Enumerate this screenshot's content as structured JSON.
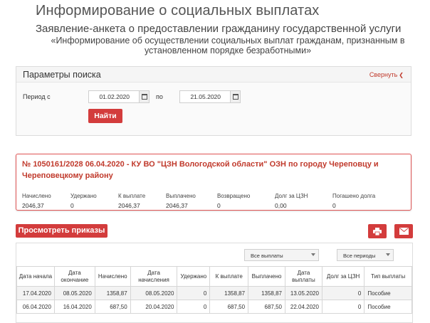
{
  "header": {
    "title": "Информирование о социальных выплатах",
    "subtitle": "Заявление-анкета о предоставлении гражданину государственной услуги",
    "service_line1": "«Информирование об осуществлении социальных выплат гражданам, признанным в",
    "service_line2": "установленном порядке безработными»"
  },
  "search": {
    "title": "Параметры поиска",
    "collapse_label": "Свернуть",
    "period_label": "Период с",
    "to_label": "по",
    "date_from": "01.02.2020",
    "date_to": "21.05.2020",
    "find_label": "Найти"
  },
  "record": {
    "title": "№ 1050161/2028 06.04.2020 - КУ ВО \"ЦЗН Вологодской области\" ОЗН по городу Череповцу и Череповецкому району",
    "stats": [
      {
        "label": "Начислено",
        "value": "2046,37"
      },
      {
        "label": "Удержано",
        "value": "0"
      },
      {
        "label": "К выплате",
        "value": "2046,37"
      },
      {
        "label": "Выплачено",
        "value": "2046,37"
      },
      {
        "label": "Возвращено",
        "value": "0"
      },
      {
        "label": "Долг за ЦЗН",
        "value": "0,00"
      },
      {
        "label": "Погашено долга",
        "value": "0"
      }
    ]
  },
  "actions": {
    "orders_label": "Просмотреть приказы",
    "print_icon": "printer-icon",
    "mail_icon": "envelope-icon"
  },
  "filters": {
    "payments_selected": "Все выплаты",
    "periods_selected": "Все периоды"
  },
  "table": {
    "headers": [
      "Дата начала",
      "Дата окончание",
      "Начислено",
      "Дата начисления",
      "Удержано",
      "К выплате",
      "Выплачено",
      "Дата выплаты",
      "Долг за ЦЗН",
      "Тип выплаты"
    ],
    "rows": [
      [
        "17.04.2020",
        "08.05.2020",
        "1358,87",
        "08.05.2020",
        "0",
        "1358,87",
        "1358,87",
        "13.05.2020",
        "0",
        "Пособие"
      ],
      [
        "06.04.2020",
        "16.04.2020",
        "687,50",
        "20.04.2020",
        "0",
        "687,50",
        "687,50",
        "22.04.2020",
        "0",
        "Пособие"
      ]
    ]
  },
  "colors": {
    "accent": "#d33c3c",
    "accent_text": "#c0392b"
  }
}
